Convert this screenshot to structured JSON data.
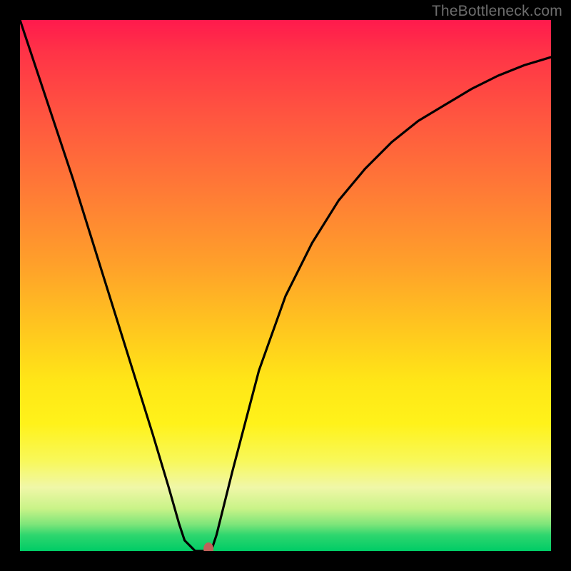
{
  "watermark": "TheBottleneck.com",
  "chart_data": {
    "type": "line",
    "title": "",
    "xlabel": "",
    "ylabel": "",
    "xlim": [
      0,
      100
    ],
    "ylim": [
      0,
      100
    ],
    "background_gradient": {
      "top": "#ff1a4d",
      "upper_mid": "#ff7a36",
      "mid": "#ffe617",
      "lower_mid": "#f0f7a8",
      "bottom": "#00cc66"
    },
    "series": [
      {
        "name": "bottleneck-curve",
        "color": "#000000",
        "x": [
          0,
          5,
          10,
          15,
          20,
          25,
          28,
          30,
          31,
          32,
          33,
          34,
          35,
          36,
          37,
          40,
          45,
          50,
          55,
          60,
          65,
          70,
          75,
          80,
          85,
          90,
          95,
          100
        ],
        "y": [
          100,
          85,
          70,
          54,
          38,
          22,
          12,
          5,
          2,
          1,
          0,
          0,
          0,
          0,
          3,
          15,
          34,
          48,
          58,
          66,
          72,
          77,
          81,
          84,
          87,
          89.5,
          91.5,
          93
        ]
      }
    ],
    "marker": {
      "name": "minimum-point",
      "x": 35.5,
      "y": 0,
      "color": "#c0615a",
      "rx": 7,
      "ry": 9
    }
  }
}
